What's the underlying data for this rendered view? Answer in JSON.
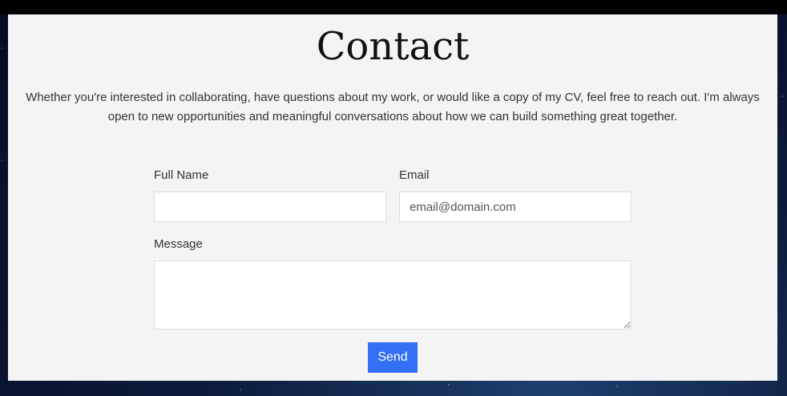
{
  "page": {
    "title": "Contact",
    "intro": "Whether you're interested in collaborating, have questions about my work, or would like a copy of my CV, feel free to reach out. I'm always open to new opportunities and meaningful conversations about how we can build something great together."
  },
  "form": {
    "full_name": {
      "label": "Full Name",
      "value": "",
      "placeholder": ""
    },
    "email": {
      "label": "Email",
      "value": "",
      "placeholder": "email@domain.com"
    },
    "message": {
      "label": "Message",
      "value": "",
      "placeholder": ""
    },
    "send_label": "Send"
  },
  "colors": {
    "accent": "#3370f5",
    "panel": "#f4f4f4"
  }
}
